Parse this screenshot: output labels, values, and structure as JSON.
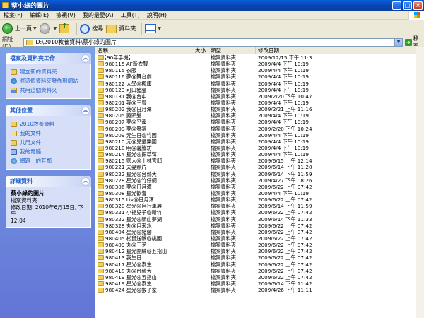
{
  "window": {
    "title": "蔡小綠的圖片"
  },
  "menu": [
    "檔案(F)",
    "編輯(E)",
    "檢視(V)",
    "我的最愛(A)",
    "工具(T)",
    "說明(H)"
  ],
  "toolbar": {
    "back": "上一頁",
    "search": "搜尋",
    "folders": "資料夾"
  },
  "address": {
    "label": "網址(D)",
    "path": "D:\\2010教養資料\\蔡小綠的圖片",
    "go": "移至"
  },
  "tasks": {
    "title": "檔案及資料夾工作",
    "items": [
      "建立新的資料夾",
      "將這個資料夾發佈到網站",
      "共用這個資料夾"
    ]
  },
  "places": {
    "title": "其他位置",
    "items": [
      "2010教養資料",
      "我的文件",
      "共用文件",
      "我的電腦",
      "網路上的芳鄰"
    ]
  },
  "details": {
    "title": "詳細資料",
    "name": "蔡小綠的圖片",
    "type": "檔案資料夾",
    "modified_line1": "修改日期: 2010年6月15日, 下午",
    "modified_line2": "12:04"
  },
  "columns": {
    "name": "名稱",
    "size": "大小",
    "type": "類型",
    "date": "修改日期"
  },
  "files": [
    {
      "name": "90年手機",
      "type": "檔案資料夾",
      "date": "2009/12/15 下午 11:30"
    },
    {
      "name": "980115 AF新衣服",
      "type": "檔案資料夾",
      "date": "2009/4/4 下午 10:19"
    },
    {
      "name": "980115 衣服",
      "type": "檔案資料夾",
      "date": "2009/4/4 下午 10:19"
    },
    {
      "name": "980116 夢@舞台劇",
      "type": "檔案資料夾",
      "date": "2009/4/4 下午 10:19"
    },
    {
      "name": "980122 大學@楓康",
      "type": "檔案資料夾",
      "date": "2009/4/4 下午 10:19"
    },
    {
      "name": "980123 可口豬腳",
      "type": "檔案資料夾",
      "date": "2009/4/4 下午 10:19"
    },
    {
      "name": "980131 我@台中",
      "type": "檔案資料夾",
      "date": "2009/2/20 下午 10:47"
    },
    {
      "name": "980201 我@三豐",
      "type": "檔案資料夾",
      "date": "2009/4/4 下午 10:19"
    },
    {
      "name": "980202 我@日月潭",
      "type": "檔案資料夾",
      "date": "2009/2/21 上午 11:16"
    },
    {
      "name": "980205 剪頭髮",
      "type": "檔案資料夾",
      "date": "2009/4/4 下午 10:19"
    },
    {
      "name": "980207 夢@平溪",
      "type": "檔案資料夾",
      "date": "2009/4/4 下午 10:19"
    },
    {
      "name": "980209 夢@發福",
      "type": "檔案資料夾",
      "date": "2009/2/20 下午 10:24"
    },
    {
      "name": "980209 元生日@竹園",
      "type": "檔案資料夾",
      "date": "2009/4/4 下午 10:19"
    },
    {
      "name": "980210 元@兒童樂園",
      "type": "檔案資料夾",
      "date": "2009/4/4 下午 10:19"
    },
    {
      "name": "980210 明@義騰坊",
      "type": "檔案資料夾",
      "date": "2009/4/4 下午 10:19"
    },
    {
      "name": "980214 星光@探草莓",
      "type": "檔案資料夾",
      "date": "2009/4/4 下午 10:19"
    },
    {
      "name": "980215 家人@士林官邸",
      "type": "檔案資料夾",
      "date": "2009/6/15 上午 12:14"
    },
    {
      "name": "980221 夫妻照片",
      "type": "檔案資料夾",
      "date": "2009/6/14 下午 11:20"
    },
    {
      "name": "980222 星光@台藝大",
      "type": "檔案資料夾",
      "date": "2009/6/14 下午 11:59"
    },
    {
      "name": "980228 星光@竹仔網",
      "type": "檔案資料夾",
      "date": "2009/4/27 下午 08:26"
    },
    {
      "name": "980306 夢@日月潭",
      "type": "檔案資料夾",
      "date": "2009/6/22 上午 07:42"
    },
    {
      "name": "980308 星光歡音",
      "type": "檔案資料夾",
      "date": "2009/4/4 下午 10:19"
    },
    {
      "name": "980315 Liv@日月潭",
      "type": "檔案資料夾",
      "date": "2009/6/22 上午 07:42"
    },
    {
      "name": "980320 星光@自行車展",
      "type": "檔案資料夾",
      "date": "2009/6/14 下午 11:59"
    },
    {
      "name": "980321 小福兒子@新竹",
      "type": "檔案資料夾",
      "date": "2009/6/22 上午 07:42"
    },
    {
      "name": "980322 星光@新山夢湖",
      "type": "檔案資料夾",
      "date": "2009/6/14 下午 11:33"
    },
    {
      "name": "980328 丸@自來水",
      "type": "檔案資料夾",
      "date": "2009/6/22 上午 07:42"
    },
    {
      "name": "980404 星光@豬腳",
      "type": "檔案資料夾",
      "date": "2009/6/22 上午 07:42"
    },
    {
      "name": "980405 松鼠送轎@桃園",
      "type": "檔案資料夾",
      "date": "2009/6/22 上午 07:42"
    },
    {
      "name": "980409 丸@三芝",
      "type": "檔案資料夾",
      "date": "2009/6/22 上午 07:42"
    },
    {
      "name": "980412 星光團練@五指山",
      "type": "檔案資料夾",
      "date": "2009/6/22 上午 07:42"
    },
    {
      "name": "980413 我生日",
      "type": "檔案資料夾",
      "date": "2009/6/22 上午 07:42"
    },
    {
      "name": "980417 星光@泰生",
      "type": "檔案資料夾",
      "date": "2009/6/22 上午 07:42"
    },
    {
      "name": "980418 丸@台藝大",
      "type": "檔案資料夾",
      "date": "2009/6/22 上午 07:42"
    },
    {
      "name": "980419 星光@五指山",
      "type": "檔案資料夾",
      "date": "2009/6/22 上午 07:42"
    },
    {
      "name": "980419 星光@泰生",
      "type": "檔案資料夾",
      "date": "2009/6/14 下午 11:42"
    },
    {
      "name": "980424 星光@猴子家",
      "type": "檔案資料夾",
      "date": "2009/4/26 下午 11:11"
    }
  ]
}
